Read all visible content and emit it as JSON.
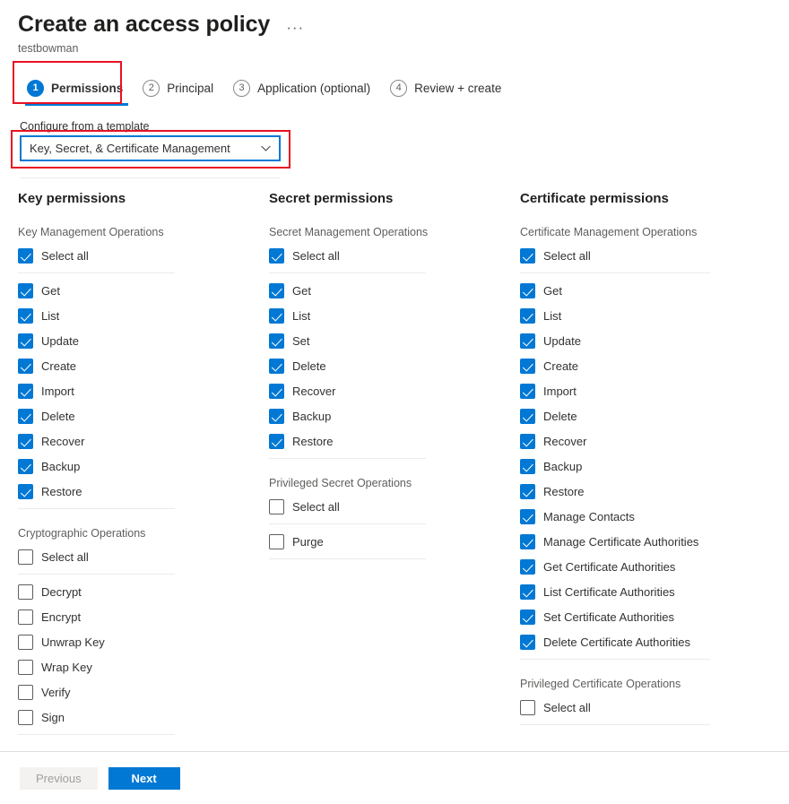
{
  "header": {
    "title": "Create an access policy",
    "subtitle": "testbowman",
    "more_menu": "···"
  },
  "wizard": {
    "tabs": [
      {
        "num": "1",
        "label": "Permissions",
        "active": true
      },
      {
        "num": "2",
        "label": "Principal",
        "active": false
      },
      {
        "num": "3",
        "label": "Application (optional)",
        "active": false
      },
      {
        "num": "4",
        "label": "Review + create",
        "active": false
      }
    ]
  },
  "template": {
    "label": "Configure from a template",
    "value": "Key, Secret, & Certificate Management"
  },
  "columns": [
    {
      "title": "Key permissions",
      "groups": [
        {
          "title": "Key Management Operations",
          "select_all": {
            "label": "Select all",
            "checked": true
          },
          "items": [
            {
              "label": "Get",
              "checked": true
            },
            {
              "label": "List",
              "checked": true
            },
            {
              "label": "Update",
              "checked": true
            },
            {
              "label": "Create",
              "checked": true
            },
            {
              "label": "Import",
              "checked": true
            },
            {
              "label": "Delete",
              "checked": true
            },
            {
              "label": "Recover",
              "checked": true
            },
            {
              "label": "Backup",
              "checked": true
            },
            {
              "label": "Restore",
              "checked": true
            }
          ]
        },
        {
          "title": "Cryptographic Operations",
          "select_all": {
            "label": "Select all",
            "checked": false
          },
          "items": [
            {
              "label": "Decrypt",
              "checked": false
            },
            {
              "label": "Encrypt",
              "checked": false
            },
            {
              "label": "Unwrap Key",
              "checked": false
            },
            {
              "label": "Wrap Key",
              "checked": false
            },
            {
              "label": "Verify",
              "checked": false
            },
            {
              "label": "Sign",
              "checked": false
            }
          ]
        }
      ]
    },
    {
      "title": "Secret permissions",
      "groups": [
        {
          "title": "Secret Management Operations",
          "select_all": {
            "label": "Select all",
            "checked": true
          },
          "items": [
            {
              "label": "Get",
              "checked": true
            },
            {
              "label": "List",
              "checked": true
            },
            {
              "label": "Set",
              "checked": true
            },
            {
              "label": "Delete",
              "checked": true
            },
            {
              "label": "Recover",
              "checked": true
            },
            {
              "label": "Backup",
              "checked": true
            },
            {
              "label": "Restore",
              "checked": true
            }
          ]
        },
        {
          "title": "Privileged Secret Operations",
          "select_all": {
            "label": "Select all",
            "checked": false
          },
          "items": [
            {
              "label": "Purge",
              "checked": false
            }
          ]
        }
      ]
    },
    {
      "title": "Certificate permissions",
      "groups": [
        {
          "title": "Certificate Management Operations",
          "select_all": {
            "label": "Select all",
            "checked": true
          },
          "items": [
            {
              "label": "Get",
              "checked": true
            },
            {
              "label": "List",
              "checked": true
            },
            {
              "label": "Update",
              "checked": true
            },
            {
              "label": "Create",
              "checked": true
            },
            {
              "label": "Import",
              "checked": true
            },
            {
              "label": "Delete",
              "checked": true
            },
            {
              "label": "Recover",
              "checked": true
            },
            {
              "label": "Backup",
              "checked": true
            },
            {
              "label": "Restore",
              "checked": true
            },
            {
              "label": "Manage Contacts",
              "checked": true
            },
            {
              "label": "Manage Certificate Authorities",
              "checked": true
            },
            {
              "label": "Get Certificate Authorities",
              "checked": true
            },
            {
              "label": "List Certificate Authorities",
              "checked": true
            },
            {
              "label": "Set Certificate Authorities",
              "checked": true
            },
            {
              "label": "Delete Certificate Authorities",
              "checked": true
            }
          ]
        },
        {
          "title": "Privileged Certificate Operations",
          "select_all": {
            "label": "Select all",
            "checked": false
          },
          "items": []
        }
      ]
    }
  ],
  "footer": {
    "previous_label": "Previous",
    "next_label": "Next"
  },
  "colors": {
    "accent": "#0078d4",
    "annotation": "#e81123",
    "divider": "#edebe9"
  }
}
